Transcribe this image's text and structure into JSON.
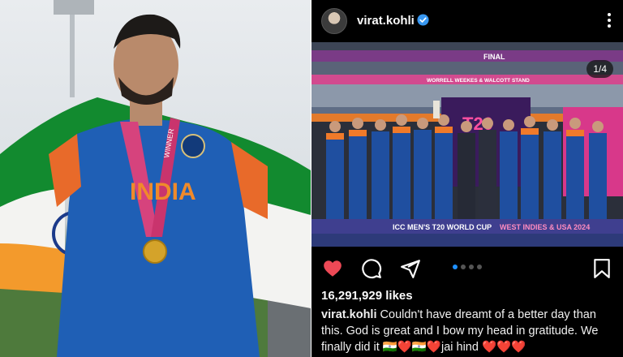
{
  "left_photo": {
    "jersey_text": "INDIA",
    "medal_ribbon_text": "WINNER"
  },
  "post": {
    "username": "virat.kohli",
    "verified": true,
    "more_icon": "more-vertical-icon",
    "carousel_counter": "1/4",
    "carousel_pages": 4,
    "carousel_active": 1,
    "photo": {
      "banner_top": "FINAL",
      "stand_name": "WORRELL WEEKES & WALCOTT STAND",
      "board_text": "ICC MEN'S T20 WORLD CUP",
      "board_suffix": "WEST INDIES & USA 2024",
      "backdrop_logo": "T20"
    },
    "likes": "16,291,929 likes",
    "caption_user": "virat.kohli",
    "caption_text": "Couldn't have dreamt of a better day than this. God is great and I bow my head in gratitude. We finally did it 🇮🇳❤️🇮🇳❤️jai hind ❤️❤️❤️",
    "actions": [
      "heart-filled-icon",
      "comment-icon",
      "share-icon",
      "bookmark-icon"
    ],
    "colors": {
      "like": "#ed4956",
      "verified": "#3897f0",
      "active_dot": "#1e90ff"
    }
  }
}
